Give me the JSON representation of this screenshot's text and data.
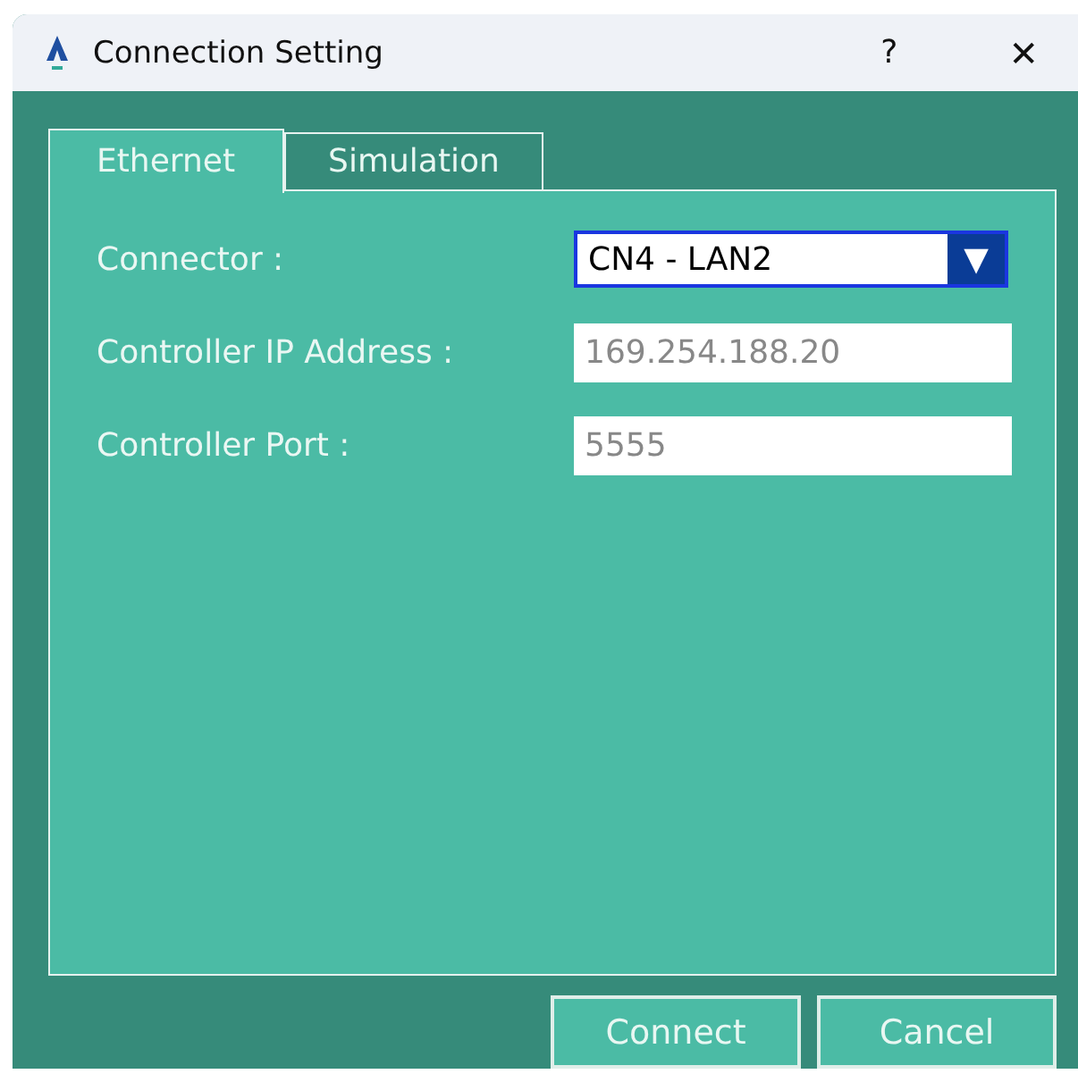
{
  "window": {
    "title": "Connection Setting",
    "help": "?",
    "close": "✕"
  },
  "tabs": [
    {
      "label": "Ethernet",
      "selected": true
    },
    {
      "label": "Simulation",
      "selected": false
    }
  ],
  "fields": [
    {
      "kind": "dropdown",
      "label": "Connector :",
      "value": "CN4 - LAN2",
      "arrow": "▼"
    },
    {
      "kind": "text",
      "label": "Controller IP Address :",
      "value": "169.254.188.20"
    },
    {
      "kind": "text",
      "label": "Controller Port :",
      "value": "5555"
    }
  ],
  "buttons": [
    "Connect",
    "Cancel"
  ]
}
